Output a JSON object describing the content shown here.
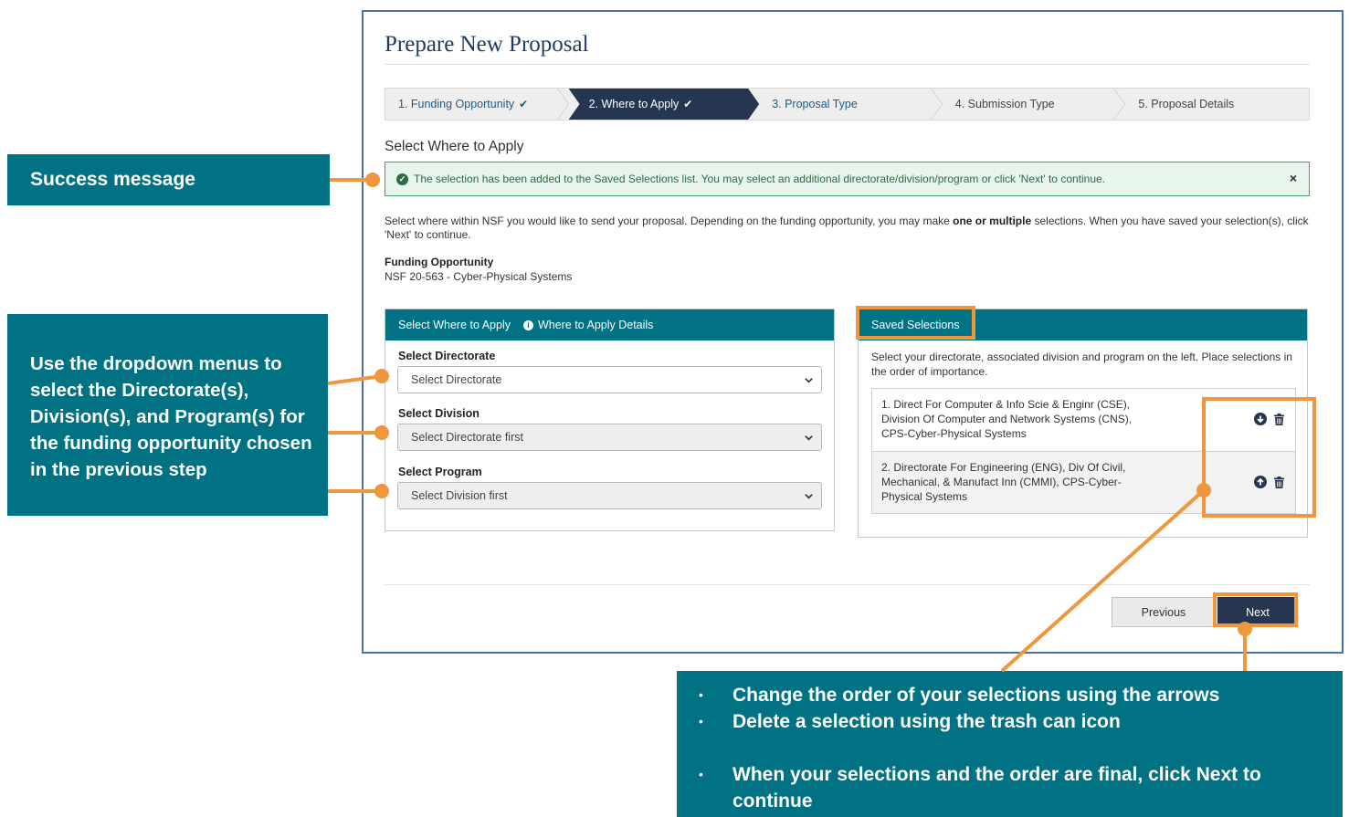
{
  "page_title": "Prepare New Proposal",
  "steps": [
    {
      "label": "1. Funding Opportunity",
      "check": "✔"
    },
    {
      "label": "2. Where to Apply",
      "check": "✔"
    },
    {
      "label": "3. Proposal Type",
      "check": ""
    },
    {
      "label": "4. Submission Type",
      "check": ""
    },
    {
      "label": "5. Proposal Details",
      "check": ""
    }
  ],
  "section_heading": "Select Where to Apply",
  "alert": {
    "message": "The selection has been added to the Saved Selections list. You may select an additional directorate/division/program or click 'Next' to continue.",
    "close": "×"
  },
  "intro": {
    "before": "Select where within NSF you would like to send your proposal. Depending on the funding opportunity, you may make ",
    "bold": "one or multiple",
    "after": " selections. When you have saved your selection(s), click 'Next' to continue."
  },
  "funding_opportunity": {
    "label": "Funding Opportunity",
    "value": "NSF 20-563 - Cyber-Physical Systems"
  },
  "left_panel": {
    "title": "Select Where to Apply",
    "details_link": "Where to Apply Details",
    "directorate_label": "Select Directorate",
    "directorate_value": "Select Directorate",
    "division_label": "Select Division",
    "division_value": "Select Directorate first",
    "program_label": "Select Program",
    "program_value": "Select Division first"
  },
  "right_panel": {
    "title": "Saved Selections",
    "description": "Select your directorate, associated division and program on the left. Place selections in the order of importance.",
    "items": [
      "1. Direct For Computer & Info Scie & Enginr (CSE), Division Of Computer and Network Systems (CNS), CPS-Cyber-Physical Systems",
      "2. Directorate For Engineering (ENG), Div Of Civil, Mechanical, & Manufact Inn (CMMI), CPS-Cyber-Physical Systems"
    ]
  },
  "buttons": {
    "previous": "Previous",
    "next": "Next"
  },
  "annotations": {
    "success": "Success message",
    "dropdowns": "Use the dropdown menus to select the Directorate(s), Division(s), and Program(s) for the funding opportunity chosen in the previous step",
    "reorder": [
      "Change the order of your selections using the arrows",
      "Delete a selection using the trash can icon",
      "When your selections and the order are final, click Next to continue"
    ]
  },
  "colors": {
    "teal": "#007284",
    "navy": "#263550",
    "orange": "#f0963c",
    "success_bg": "#e7f5ec",
    "success_border": "#49a06a"
  }
}
